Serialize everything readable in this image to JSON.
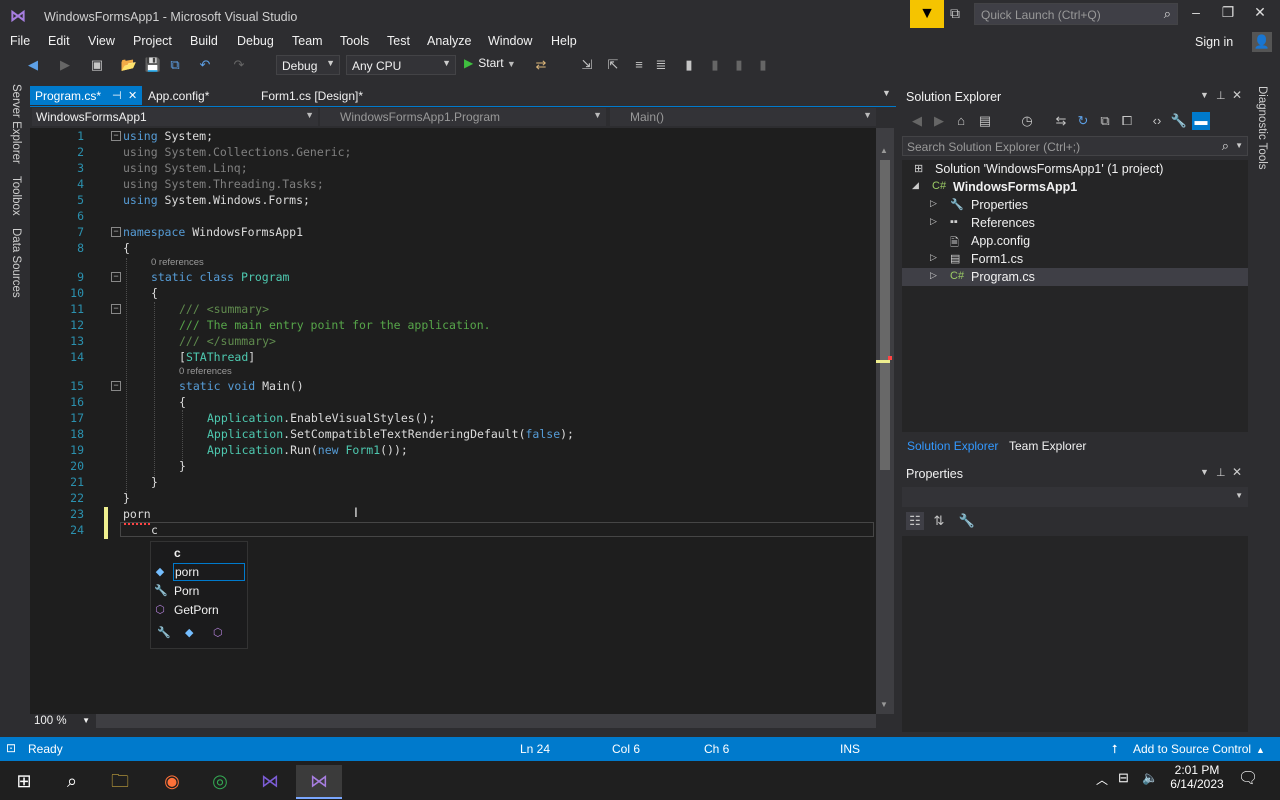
{
  "window": {
    "title": "WindowsFormsApp1 - Microsoft Visual Studio"
  },
  "quick_launch": {
    "placeholder": "Quick Launch (Ctrl+Q)"
  },
  "menu": [
    "File",
    "Edit",
    "View",
    "Project",
    "Build",
    "Debug",
    "Team",
    "Tools",
    "Test",
    "Analyze",
    "Window",
    "Help"
  ],
  "sign_in": "Sign in",
  "toolbar": {
    "config": "Debug",
    "platform": "Any CPU",
    "start": "Start"
  },
  "side_tabs": [
    "Server Explorer",
    "Toolbox",
    "Data Sources"
  ],
  "doc_tabs": [
    "Program.cs*",
    "App.config*",
    "Form1.cs [Design]*"
  ],
  "nav": {
    "project": "WindowsFormsApp1",
    "type": "WindowsFormsApp1.Program",
    "member": "Main()"
  },
  "line_numbers": [
    "1",
    "2",
    "3",
    "4",
    "5",
    "6",
    "7",
    "8",
    "9",
    "10",
    "11",
    "12",
    "13",
    "14",
    "15",
    "16",
    "17",
    "18",
    "19",
    "20",
    "21",
    "22",
    "23",
    "24"
  ],
  "code": {
    "l1_kw": "using",
    "l1_rest": " System;",
    "l2": "using System.Collections.Generic;",
    "l3": "using System.Linq;",
    "l4": "using System.Threading.Tasks;",
    "l5_kw": "using",
    "l5_rest": " System.Windows.Forms;",
    "l7_kw": "namespace",
    "l7_rest": " WindowsFormsApp1",
    "l8": "{",
    "ref1": "0 references",
    "l9_kw": "static class",
    "l9_ty": " Program",
    "l10": "{",
    "l11": "/// <summary>",
    "l12": "/// The main entry point for the application.",
    "l13": "/// </summary>",
    "l14_a": "[",
    "l14_ty": "STAThread",
    "l14_b": "]",
    "ref2": "0 references",
    "l15_kw": "static void",
    "l15_rest": " Main()",
    "l16": "{",
    "l17_ty": "Application",
    "l17_rest": ".EnableVisualStyles();",
    "l18_ty": "Application",
    "l18_rest": ".SetCompatibleTextRenderingDefault(",
    "l18_kw": "false",
    "l18_end": ");",
    "l19_ty": "Application",
    "l19_rest": ".Run(",
    "l19_kw": "new",
    "l19_ty2": " Form1",
    "l19_end": "());",
    "l20": "}",
    "l21": "}",
    "l22": "}",
    "l23": "porn",
    "l24": "c"
  },
  "completion": {
    "typed": "c",
    "items": [
      {
        "icon": "field-icon",
        "label": "porn"
      },
      {
        "icon": "wrench-icon",
        "label": "Porn"
      },
      {
        "icon": "method-icon",
        "label": "GetPorn"
      }
    ]
  },
  "zoom": "100 %",
  "solution_explorer": {
    "title": "Solution Explorer",
    "search_placeholder": "Search Solution Explorer (Ctrl+;)",
    "solution": "Solution 'WindowsFormsApp1' (1 project)",
    "project": "WindowsFormsApp1",
    "items": [
      "Properties",
      "References",
      "App.config",
      "Form1.cs",
      "Program.cs"
    ],
    "tabs": [
      "Solution Explorer",
      "Team Explorer"
    ]
  },
  "properties": {
    "title": "Properties"
  },
  "diagnostic_tools": "Diagnostic Tools",
  "status": {
    "ready": "Ready",
    "ln": "Ln 24",
    "col": "Col 6",
    "ch": "Ch 6",
    "ins": "INS",
    "source_control": "Add to Source Control"
  },
  "clock": {
    "time": "2:01 PM",
    "date": "6/14/2023"
  },
  "colors": {
    "accent": "#007acc",
    "keyword": "#569cd6",
    "type": "#4ec9b0",
    "comment": "#57a64a",
    "line_number": "#2b91af"
  }
}
